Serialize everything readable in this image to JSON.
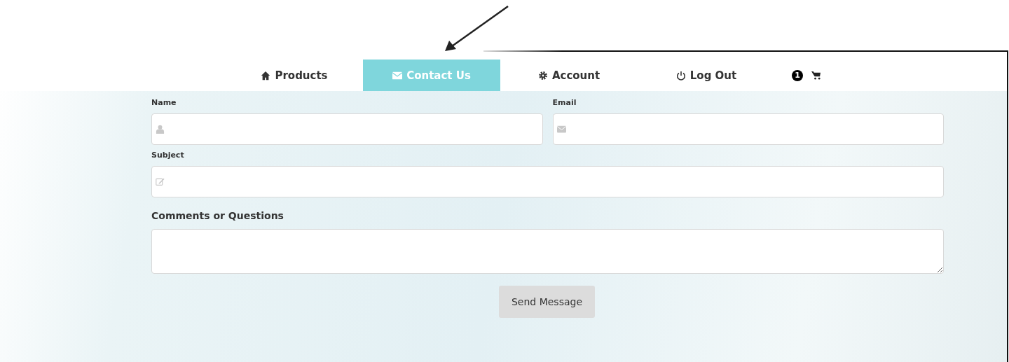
{
  "nav": {
    "tabs": [
      {
        "label": "Products",
        "selected": false
      },
      {
        "label": "Contact Us",
        "selected": true
      },
      {
        "label": "Account",
        "selected": false
      },
      {
        "label": "Log Out",
        "selected": false
      }
    ],
    "cart": {
      "count": "1"
    }
  },
  "form": {
    "fields": [
      {
        "label": "Name",
        "kind": "input"
      },
      {
        "label": "Email",
        "kind": "input"
      },
      {
        "label": "Subject",
        "kind": "input"
      },
      {
        "label": "Comments or Questions",
        "kind": "textarea"
      }
    ],
    "submit": "Send Message"
  }
}
